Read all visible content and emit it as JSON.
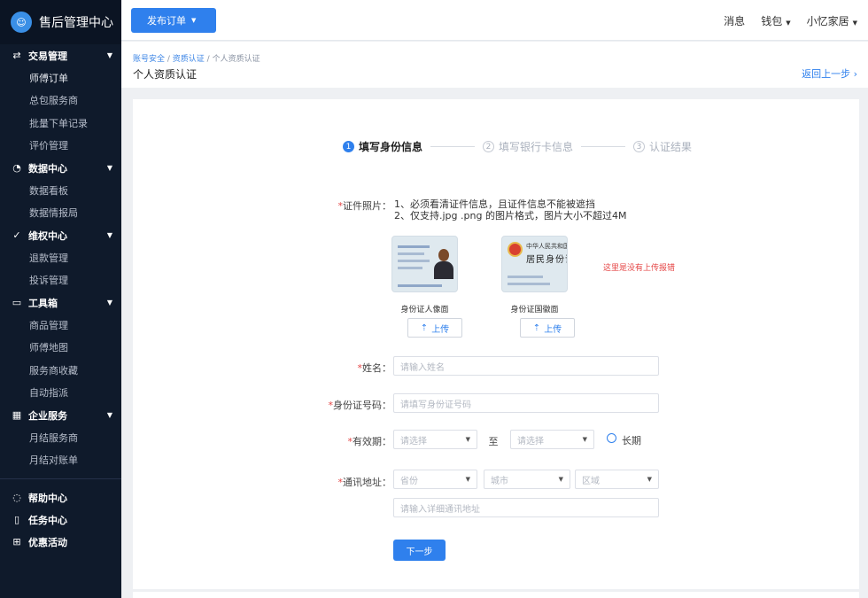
{
  "app": {
    "title": "售后管理中心"
  },
  "sidebar": {
    "groups": [
      {
        "label": "交易管理",
        "icon": "exchange-icon",
        "glyph": "⇄",
        "items": [
          "师傅订单",
          "总包服务商",
          "批量下单记录",
          "评价管理"
        ]
      },
      {
        "label": "数据中心",
        "icon": "pie-chart-icon",
        "glyph": "◔",
        "items": [
          "数据看板",
          "数据情报局"
        ]
      },
      {
        "label": "维权中心",
        "icon": "shield-check-icon",
        "glyph": "✓",
        "items": [
          "退款管理",
          "投诉管理"
        ]
      },
      {
        "label": "工具箱",
        "icon": "toolbox-icon",
        "glyph": "▭",
        "items": [
          "商品管理",
          "师傅地图",
          "服务商收藏",
          "自动指派"
        ]
      },
      {
        "label": "企业服务",
        "icon": "building-icon",
        "glyph": "▦",
        "items": [
          "月结服务商",
          "月结对账单"
        ]
      }
    ],
    "bottom": [
      {
        "label": "帮助中心",
        "icon": "help-chat-icon",
        "glyph": "◌"
      },
      {
        "label": "任务中心",
        "icon": "task-doc-icon",
        "glyph": "▯"
      },
      {
        "label": "优惠活动",
        "icon": "gift-icon",
        "glyph": "⊞"
      }
    ]
  },
  "topbar": {
    "publish": "发布订单",
    "messages": "消息",
    "wallet": "钱包",
    "user": "小忆家居"
  },
  "breadcrumb": {
    "a": "账号安全",
    "b": "资质认证",
    "c": "个人资质认证",
    "sep": " / "
  },
  "page": {
    "title": "个人资质认证",
    "back": "返回上一步"
  },
  "steps": [
    {
      "n": "1",
      "label": "填写身份信息"
    },
    {
      "n": "2",
      "label": "填写银行卡信息"
    },
    {
      "n": "3",
      "label": "认证结果"
    }
  ],
  "form": {
    "photo_label": "证件照片：",
    "note1": "1、必须看清证件信息，且证件信息不能被遮挡",
    "note2": "2、仅支持.jpg .png 的图片格式，图片大小不超过4M",
    "front_caption": "身份证人像面",
    "back_caption": "身份证国徽面",
    "upload": "上传",
    "error": "这里是没有上传报错",
    "card_back_title1": "中华人民共和国",
    "card_back_title2": "居民身份证",
    "name_label": "姓名：",
    "name_placeholder": "请输入姓名",
    "id_label": "身份证号码：",
    "id_placeholder": "请填写身份证号码",
    "valid_label": "有效期：",
    "select_placeholder": "请选择",
    "to": "至",
    "long_term": "长期",
    "addr_label": "通讯地址：",
    "province": "省份",
    "city": "城市",
    "district": "区域",
    "addr_placeholder": "请输入详细通讯地址",
    "next": "下一步",
    "required_mark": "*"
  }
}
